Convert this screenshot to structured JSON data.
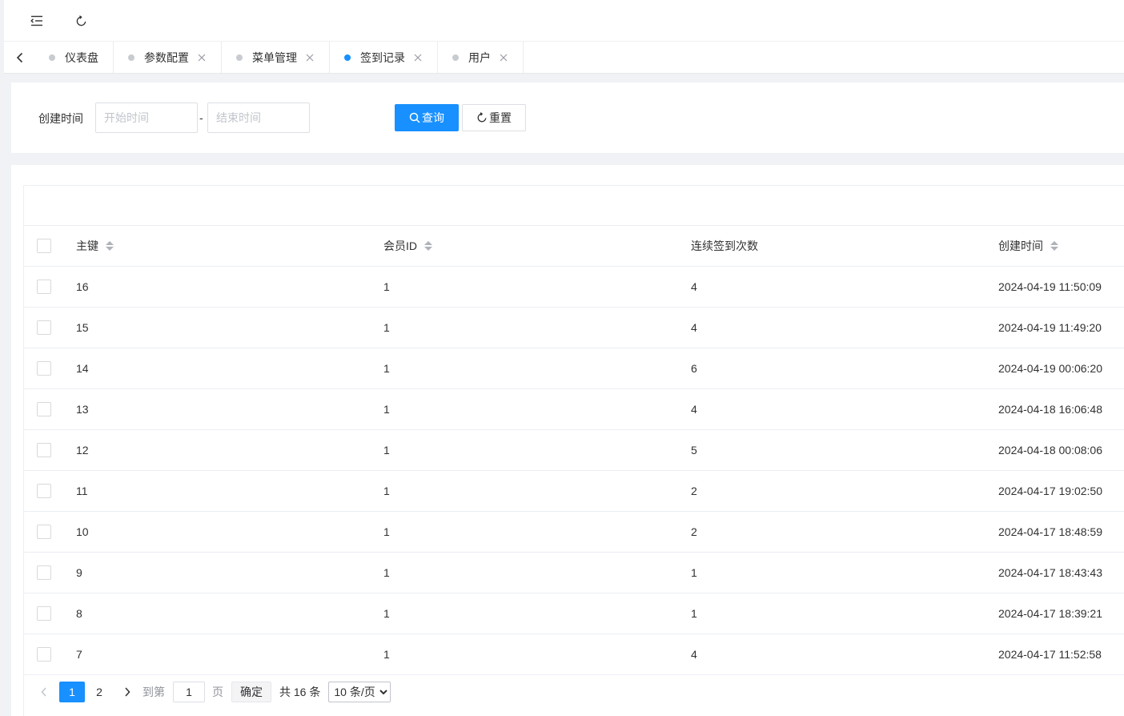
{
  "colors": {
    "primary": "#1890ff",
    "inactive_dot": "#c8cbd0",
    "border": "#ebeef5"
  },
  "header": {
    "icons": [
      "menu-fold-icon",
      "refresh-icon"
    ]
  },
  "tabs": [
    {
      "label": "仪表盘",
      "closable": false,
      "active": false
    },
    {
      "label": "参数配置",
      "closable": true,
      "active": false
    },
    {
      "label": "菜单管理",
      "closable": true,
      "active": false
    },
    {
      "label": "签到记录",
      "closable": true,
      "active": true
    },
    {
      "label": "用户",
      "closable": true,
      "active": false
    }
  ],
  "search": {
    "label": "创建时间",
    "start_placeholder": "开始时间",
    "end_placeholder": "结束时间",
    "separator": "-",
    "query_label": "查询",
    "reset_label": "重置"
  },
  "table": {
    "columns": [
      "主键",
      "会员ID",
      "连续签到次数",
      "创建时间"
    ],
    "rows": [
      {
        "id": "16",
        "member": "1",
        "count": "4",
        "time": "2024-04-19 11:50:09"
      },
      {
        "id": "15",
        "member": "1",
        "count": "4",
        "time": "2024-04-19 11:49:20"
      },
      {
        "id": "14",
        "member": "1",
        "count": "6",
        "time": "2024-04-19 00:06:20"
      },
      {
        "id": "13",
        "member": "1",
        "count": "4",
        "time": "2024-04-18 16:06:48"
      },
      {
        "id": "12",
        "member": "1",
        "count": "5",
        "time": "2024-04-18 00:08:06"
      },
      {
        "id": "11",
        "member": "1",
        "count": "2",
        "time": "2024-04-17 19:02:50"
      },
      {
        "id": "10",
        "member": "1",
        "count": "2",
        "time": "2024-04-17 18:48:59"
      },
      {
        "id": "9",
        "member": "1",
        "count": "1",
        "time": "2024-04-17 18:43:43"
      },
      {
        "id": "8",
        "member": "1",
        "count": "1",
        "time": "2024-04-17 18:39:21"
      },
      {
        "id": "7",
        "member": "1",
        "count": "4",
        "time": "2024-04-17 11:52:58"
      }
    ]
  },
  "pagination": {
    "pages": [
      "1",
      "2"
    ],
    "current": "1",
    "goto_prefix": "到第",
    "goto_value": "1",
    "goto_suffix": "页",
    "confirm_label": "确定",
    "total_text": "共 16 条",
    "page_size_options": [
      "10 条/页"
    ],
    "page_size_selected": "10 条/页"
  }
}
